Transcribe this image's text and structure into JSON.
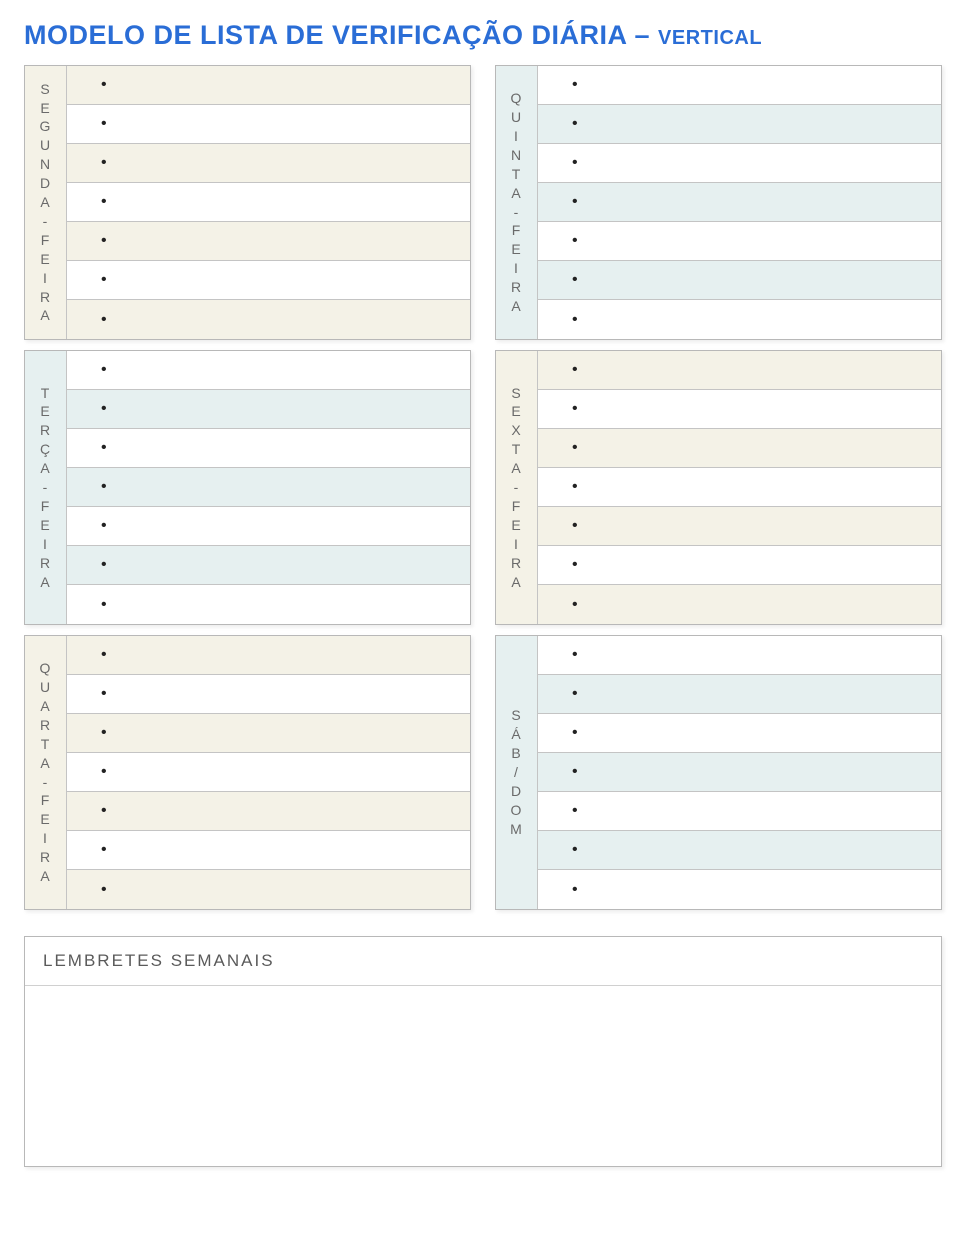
{
  "title_main": "MODELO DE LISTA DE VERIFICAÇÃO DIÁRIA",
  "title_sep": " – ",
  "title_sub": "VERTICAL",
  "days": [
    {
      "key": "segunda",
      "label": "SEGUNDA-FEIRA",
      "bg_label": "cream",
      "row_a": "cream",
      "row_b": "white",
      "items": [
        "",
        "",
        "",
        "",
        "",
        "",
        ""
      ]
    },
    {
      "key": "terca",
      "label": "TERÇA-FEIRA",
      "bg_label": "blue",
      "row_a": "white",
      "row_b": "blue",
      "items": [
        "",
        "",
        "",
        "",
        "",
        "",
        ""
      ]
    },
    {
      "key": "quarta",
      "label": "QUARTA-FEIRA",
      "bg_label": "cream",
      "row_a": "cream",
      "row_b": "white",
      "items": [
        "",
        "",
        "",
        "",
        "",
        "",
        ""
      ]
    },
    {
      "key": "quinta",
      "label": "QUINTA-FEIRA",
      "bg_label": "blue",
      "row_a": "white",
      "row_b": "blue",
      "items": [
        "",
        "",
        "",
        "",
        "",
        "",
        ""
      ]
    },
    {
      "key": "sexta",
      "label": "SEXTA-FEIRA",
      "bg_label": "cream",
      "row_a": "cream",
      "row_b": "white",
      "items": [
        "",
        "",
        "",
        "",
        "",
        "",
        ""
      ]
    },
    {
      "key": "sabdom",
      "label": "SÁB/DOM",
      "bg_label": "blue",
      "row_a": "white",
      "row_b": "blue",
      "items": [
        "",
        "",
        "",
        "",
        "",
        "",
        ""
      ]
    }
  ],
  "reminders_header": "LEMBRETES SEMANAIS",
  "reminders_body": ""
}
